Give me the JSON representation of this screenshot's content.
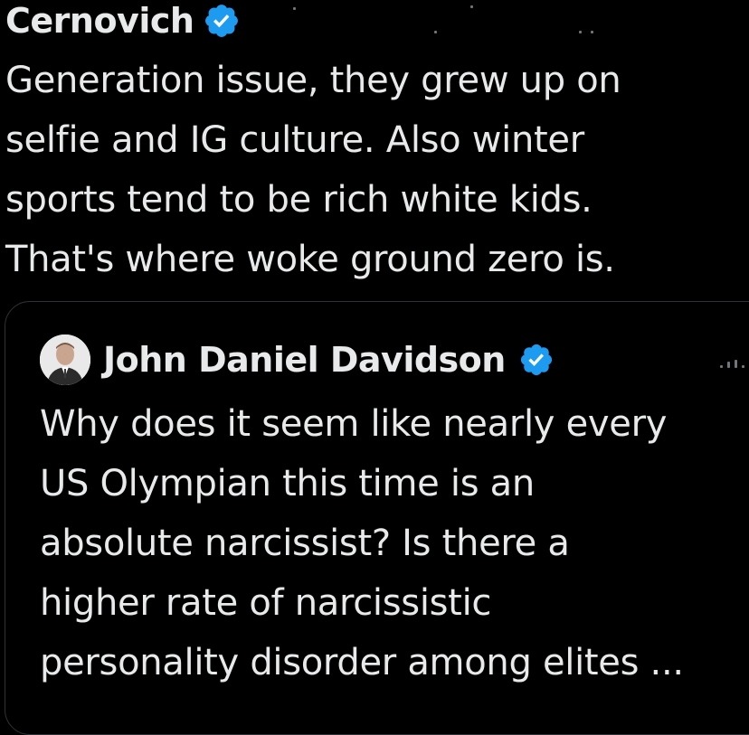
{
  "main_tweet": {
    "author_name": "Cernovich",
    "verified_icon": "verified-badge-icon",
    "text_lines": [
      "Generation issue, they grew up on",
      "selfie and IG culture. Also winter",
      "sports tend to be rich white kids.",
      "That's where woke ground zero is."
    ]
  },
  "quoted_tweet": {
    "avatar_icon": "avatar",
    "author_name": "John Daniel Davidson",
    "verified_icon": "verified-badge-icon",
    "text_lines": [
      "Why does it seem like nearly every",
      "US Olympian this time is an",
      "absolute narcissist? Is there a",
      "higher rate of narcissistic",
      "personality disorder among elites ..."
    ]
  },
  "colors": {
    "background": "#000000",
    "text": "#e7e9ea",
    "verified_blue": "#1d9bf0",
    "border": "#2f3336",
    "muted": "#71767b"
  }
}
